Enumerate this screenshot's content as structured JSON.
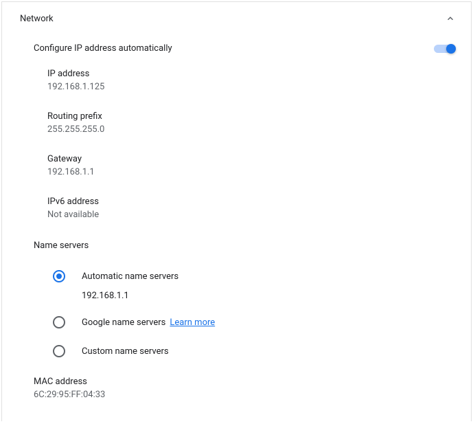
{
  "section": {
    "title": "Network"
  },
  "config": {
    "auto_ip_label": "Configure IP address automatically",
    "auto_ip_enabled": true
  },
  "fields": {
    "ip_address": {
      "label": "IP address",
      "value": "192.168.1.125"
    },
    "routing_prefix": {
      "label": "Routing prefix",
      "value": "255.255.255.0"
    },
    "gateway": {
      "label": "Gateway",
      "value": "192.168.1.1"
    },
    "ipv6": {
      "label": "IPv6 address",
      "value": "Not available"
    }
  },
  "name_servers": {
    "header": "Name servers",
    "options": {
      "automatic": {
        "label": "Automatic name servers",
        "value": "192.168.1.1"
      },
      "google": {
        "label": "Google name servers",
        "learn_more": "Learn more"
      },
      "custom": {
        "label": "Custom name servers"
      }
    }
  },
  "mac": {
    "label": "MAC address",
    "value": "6C:29:95:FF:04:33"
  }
}
